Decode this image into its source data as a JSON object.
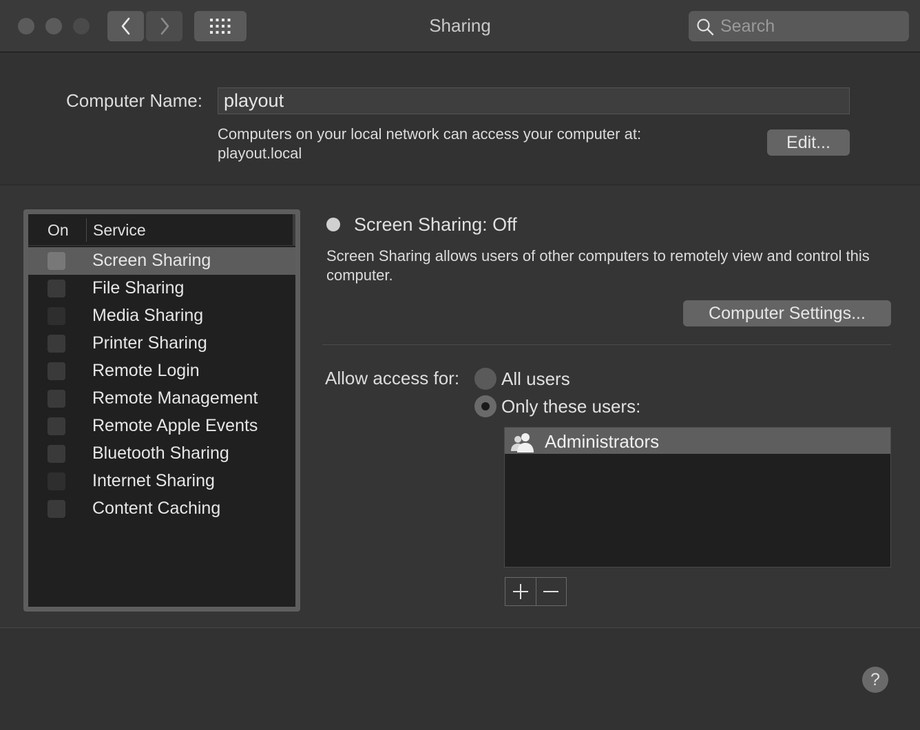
{
  "window": {
    "title": "Sharing"
  },
  "toolbar": {
    "search_placeholder": "Search"
  },
  "computer_name": {
    "label": "Computer Name:",
    "value": "playout",
    "note_line1": "Computers on your local network can access your computer at:",
    "note_line2": "playout.local",
    "edit_label": "Edit..."
  },
  "services": {
    "header_on": "On",
    "header_service": "Service",
    "items": [
      {
        "label": "Screen Sharing",
        "checked": false,
        "selected": true
      },
      {
        "label": "File Sharing",
        "checked": false
      },
      {
        "label": "Media Sharing",
        "checked": false
      },
      {
        "label": "Printer Sharing",
        "checked": false
      },
      {
        "label": "Remote Login",
        "checked": false
      },
      {
        "label": "Remote Management",
        "checked": false
      },
      {
        "label": "Remote Apple Events",
        "checked": false
      },
      {
        "label": "Bluetooth Sharing",
        "checked": false
      },
      {
        "label": "Internet Sharing",
        "checked": false
      },
      {
        "label": "Content Caching",
        "checked": false
      }
    ]
  },
  "detail": {
    "status": "Screen Sharing: Off",
    "description": "Screen Sharing allows users of other computers to remotely view and control this computer.",
    "settings_button": "Computer Settings...",
    "access_label": "Allow access for:",
    "option_all": "All users",
    "option_only": "Only these users:",
    "selected_option": "Only these users:",
    "users": [
      "Administrators"
    ]
  },
  "footer": {
    "help_label": "?"
  },
  "icons": {
    "back": "chevron-left-icon",
    "forward": "chevron-right-icon",
    "grid": "grid-icon",
    "search": "search-icon",
    "group": "user-group-icon",
    "add": "plus-icon",
    "remove": "minus-icon"
  }
}
